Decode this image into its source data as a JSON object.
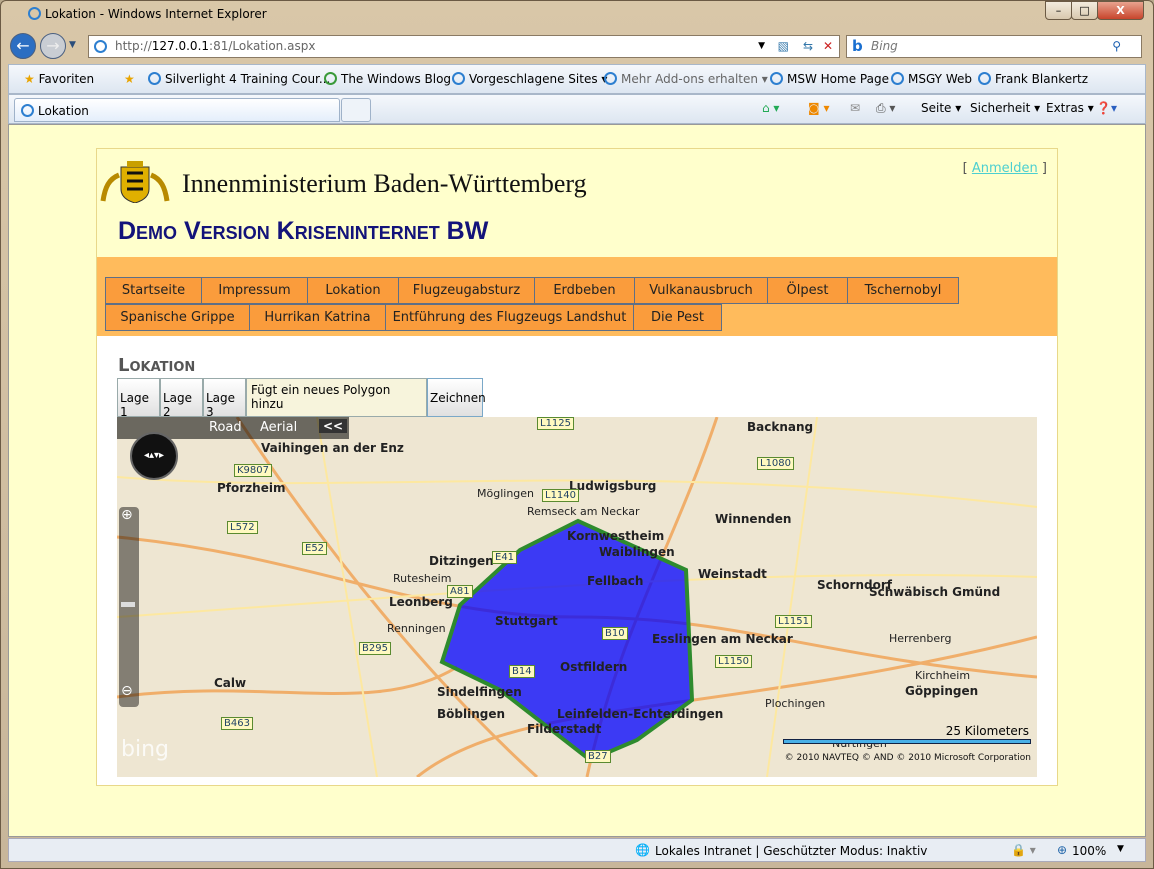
{
  "window": {
    "title": "Lokation - Windows Internet Explorer",
    "minimize": "–",
    "maximize": "□",
    "close": "X"
  },
  "address": {
    "prefix": "http://",
    "host": "127.0.0.1",
    "rest": ":81/Lokation.aspx"
  },
  "search": {
    "placeholder": "Bing"
  },
  "favorites": {
    "label": "Favoriten",
    "items": [
      "Silverlight 4 Training Cour...",
      "The Windows Blog",
      "Vorgeschlagene Sites ▾",
      "Mehr Add-ons erhalten ▾",
      "MSW Home Page",
      "MSGY Web",
      "Frank Blankertz"
    ]
  },
  "tab": {
    "label": "Lokation"
  },
  "commands": {
    "seite": "Seite ▾",
    "sicherheit": "Sicherheit ▾",
    "extras": "Extras ▾"
  },
  "header": {
    "ministry": "Innenministerium Baden-Württemberg",
    "demo": "Demo Version Kriseninternet BW",
    "login_open": "[ ",
    "login": "Anmelden",
    "login_close": " ]"
  },
  "nav": {
    "row1": [
      "Startseite",
      "Impressum",
      "Lokation",
      "Flugzeugabsturz",
      "Erdbeben",
      "Vulkanausbruch",
      "Ölpest",
      "Tschernobyl"
    ],
    "row2": [
      "Spanische Grippe",
      "Hurrikan Katrina",
      "Entführung des Flugzeugs Landshut",
      "Die Pest"
    ]
  },
  "content": {
    "heading": "Lokation",
    "buttons": [
      "Lage 1",
      "Lage 2",
      "Lage 3"
    ],
    "tooltip": "Fügt ein neues Polygon hinzu",
    "draw": "Zeichnen"
  },
  "map": {
    "road": "Road",
    "aerial": "Aerial",
    "collapse": "<<",
    "scale": "25 Kilometers",
    "copyright": "© 2010 NAVTEQ  © AND   © 2010 Microsoft Corporation",
    "logo": "bing",
    "polygon_color": "#0000ff",
    "polygon_stroke": "#2e8b2e",
    "labels": [
      [
        "Stuttgart",
        1
      ],
      [
        "Ludwigsburg",
        1
      ],
      [
        "Kornwestheim",
        1
      ],
      [
        "Waiblingen",
        1
      ],
      [
        "Fellbach",
        1
      ],
      [
        "Weinstadt",
        1
      ],
      [
        "Esslingen am Neckar",
        1
      ],
      [
        "Ostfildern",
        1
      ],
      [
        "Leinfelden-Echterdingen",
        1
      ],
      [
        "Filderstadt",
        1
      ],
      [
        "Sindelfingen",
        1
      ],
      [
        "Böblingen",
        1
      ],
      [
        "Leonberg",
        1
      ],
      [
        "Ditzingen",
        1
      ],
      [
        "Pforzheim",
        1
      ],
      [
        "Vaihingen an der Enz",
        1
      ],
      [
        "Backnang",
        1
      ],
      [
        "Winnenden",
        1
      ],
      [
        "Schorndorf",
        1
      ],
      [
        "Schwäbisch Gmünd",
        1
      ],
      [
        "Göppingen",
        1
      ],
      [
        "Calw",
        1
      ],
      [
        "Plochingen",
        0
      ],
      [
        "Nürtingen",
        0
      ],
      [
        "Möglingen",
        0
      ],
      [
        "Remseck am Neckar",
        0
      ],
      [
        "Rutesheim",
        0
      ],
      [
        "Renningen",
        0
      ],
      [
        "Herrenberg",
        0
      ],
      [
        "Kirchheim",
        0
      ]
    ],
    "roads": [
      "A81",
      "B14",
      "E52",
      "E41",
      "L1140",
      "B10",
      "L1150",
      "L1151",
      "B27",
      "K9807",
      "L572",
      "B295",
      "B463",
      "L1125",
      "L1080"
    ]
  },
  "status": {
    "zone": "Lokales Intranet | Geschützter Modus: Inaktiv",
    "zoom": "100%"
  }
}
